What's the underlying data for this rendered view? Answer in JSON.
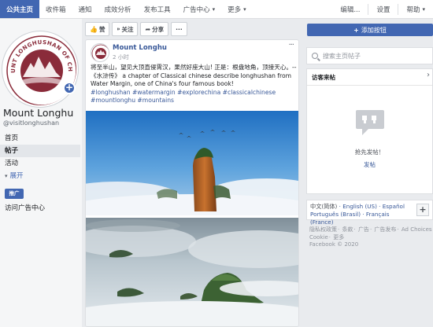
{
  "topbar": {
    "tabs": [
      {
        "label": "公共主页",
        "active": true
      },
      {
        "label": "收件箱"
      },
      {
        "label": "通知"
      },
      {
        "label": "成效分析"
      },
      {
        "label": "发布工具"
      },
      {
        "label": "广告中心",
        "dropdown": true
      },
      {
        "label": "更多",
        "dropdown": true
      }
    ],
    "right": [
      {
        "label": "编辑..."
      },
      {
        "label": "设置"
      },
      {
        "label": "帮助",
        "dropdown": true
      }
    ]
  },
  "page": {
    "name": "Mount Longhu",
    "handle": "@visitlonghushan",
    "logo_text": "MOUNT LONGHUSHAN OF CHINA"
  },
  "left_nav": {
    "items": [
      "首页",
      "帖子",
      "活动"
    ],
    "selected": "帖子",
    "more": "展开",
    "promote": "推广",
    "ad_center": "访问广告中心"
  },
  "actions": {
    "like": "赞",
    "follow": "关注",
    "share": "分享",
    "more": "···"
  },
  "post": {
    "author": "Mount Longhu",
    "time": "2 小时",
    "menu": "···",
    "text": "将至半山，望见大顶直侵霄汉，果然好座大山! 正是：根盘地角，顶接天心。-- 《水浒传》 a chapter of Classical chinese describe longhushan from Water Margin, one of China's four famous book!",
    "hashtags": "#longhushan #watermargin #explorechina #classicalchinese #mountlonghu #mountains"
  },
  "right": {
    "add_button": "添加按钮",
    "search_placeholder": "搜索主页帖子",
    "visitor_title": "访客来帖",
    "empty_text": "抢先发帖！",
    "post_link": "发帖",
    "languages_current": "中文(简体)",
    "languages": [
      "English (US)",
      "Español",
      "Português (Brasil)",
      "Français (France)"
    ],
    "footer_links": [
      "隐私权政策",
      "条款",
      "广告",
      "广告发布",
      "Ad Choices",
      "Cookie",
      "更多"
    ],
    "copyright": "Facebook © 2020"
  },
  "colors": {
    "brand": "#4267b2",
    "link": "#385898",
    "logo": "#8a2b3a"
  }
}
